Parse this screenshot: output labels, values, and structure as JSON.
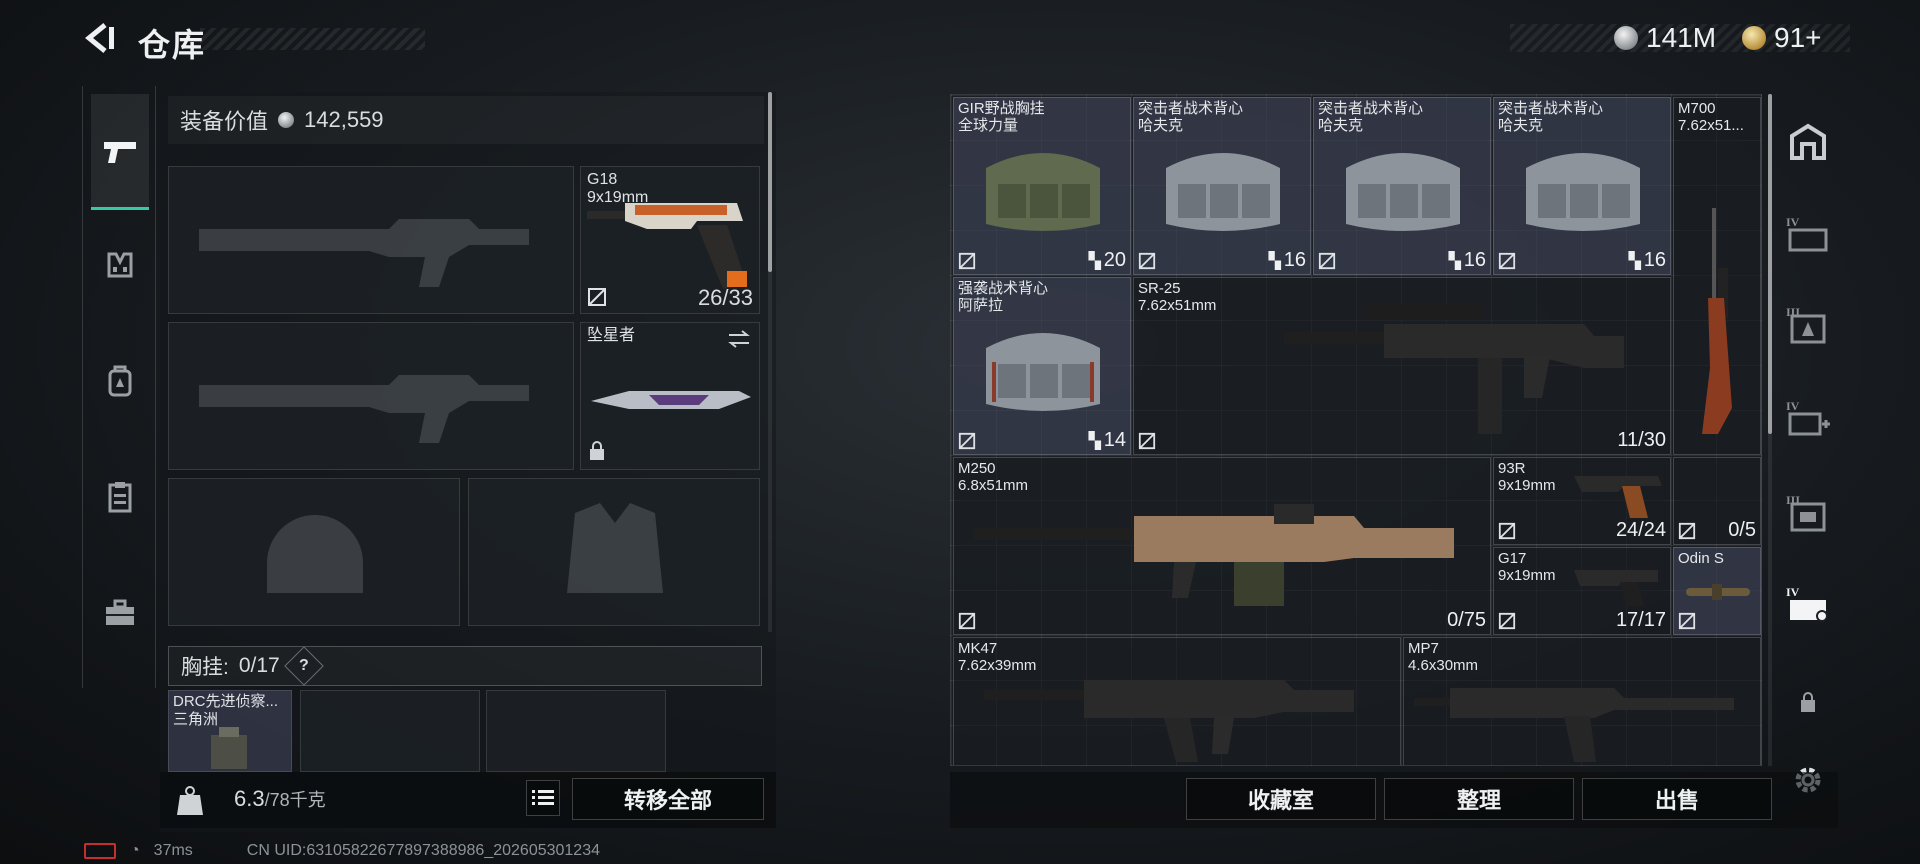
{
  "header": {
    "title": "仓库",
    "currencies": [
      {
        "icon": "silver-coin-icon",
        "value": "141M"
      },
      {
        "icon": "gold-coin-icon",
        "value": "91+"
      }
    ]
  },
  "left_rail": {
    "items": [
      {
        "icon": "pistol-icon",
        "active": true
      },
      {
        "icon": "chest-rig-icon"
      },
      {
        "icon": "backpack-icon"
      },
      {
        "icon": "clipboard-icon"
      },
      {
        "icon": "toolbox-icon"
      }
    ]
  },
  "loadout": {
    "value_label": "装备价值",
    "value": "142,559",
    "pistol": {
      "name": "G18",
      "caliber": "9x19mm",
      "ammo": "26/33"
    },
    "melee": {
      "name": "坠星者"
    },
    "chest_rig_label": "胸挂:",
    "chest_rig_count": "0/17",
    "help": "?",
    "chest_item": {
      "name": "DRC先进侦察...",
      "maker": "三角洲"
    },
    "weight": "6.3",
    "weight_max": "/78千克",
    "transfer_all": "转移全部"
  },
  "stash": {
    "items": [
      {
        "name": "GIR野战胸挂",
        "sub": "全球力量",
        "count": "20",
        "kind": "rig-green"
      },
      {
        "name": "突击者战术背心",
        "sub": "哈夫克",
        "count": "16",
        "kind": "rig-grey"
      },
      {
        "name": "突击者战术背心",
        "sub": "哈夫克",
        "count": "16",
        "kind": "rig-grey"
      },
      {
        "name": "突击者战术背心",
        "sub": "哈夫克",
        "count": "16",
        "kind": "rig-grey"
      },
      {
        "name": "M700",
        "sub": "7.62x51...",
        "count": "",
        "kind": "rifle-vertical"
      },
      {
        "name": "强袭战术背心",
        "sub": "阿萨拉",
        "count": "14",
        "kind": "rig-grey"
      },
      {
        "name": "SR-25",
        "sub": "7.62x51mm",
        "count": "11/30",
        "kind": "rifle"
      },
      {
        "name": "M250",
        "sub": "6.8x51mm",
        "count": "0/75",
        "kind": "lmg"
      },
      {
        "name": "93R",
        "sub": "9x19mm",
        "count": "24/24",
        "kind": "pistol"
      },
      {
        "name": "",
        "sub": "",
        "count": "0/5",
        "kind": "empty"
      },
      {
        "name": "G17",
        "sub": "9x19mm",
        "count": "17/17",
        "kind": "pistol"
      },
      {
        "name": "Odin S",
        "sub": "",
        "count": "",
        "kind": "scope"
      },
      {
        "name": "MK47",
        "sub": "7.62x39mm",
        "count": "",
        "kind": "rifle"
      },
      {
        "name": "MP7",
        "sub": "4.6x30mm",
        "count": "",
        "kind": "smg"
      }
    ],
    "buttons": {
      "collection": "收藏室",
      "sort": "整理",
      "sell": "出售"
    }
  },
  "right_rail": {
    "items": [
      {
        "icon": "safehouse-icon"
      },
      {
        "icon": "stash-tab-iv-icon",
        "label": "IV"
      },
      {
        "icon": "stash-tab-iii-icon",
        "label": "III"
      },
      {
        "icon": "stash-tab-iv-add-icon",
        "label": "IV"
      },
      {
        "icon": "stash-tab-iii-b-icon",
        "label": "III"
      },
      {
        "icon": "stash-tab-iv-active-icon",
        "label": "IV"
      },
      {
        "icon": "lock-icon"
      },
      {
        "icon": "settings-gear-icon"
      }
    ]
  },
  "status_bar": {
    "ping": "37ms",
    "uid": "CN UID:63105822677897388986_202605301234"
  }
}
